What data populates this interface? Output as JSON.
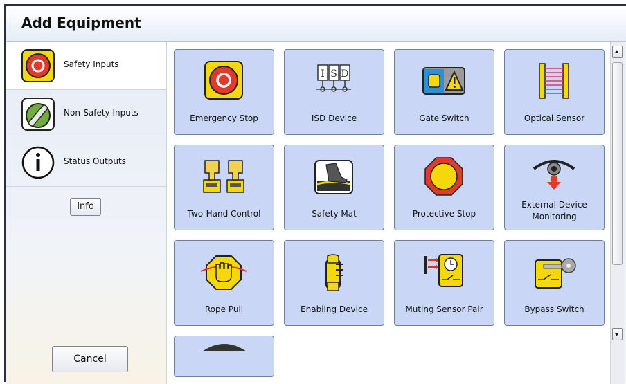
{
  "window": {
    "title": "Add Equipment"
  },
  "sidebar": {
    "items": [
      {
        "label": "Safety Inputs",
        "icon": "emergency-stop-icon"
      },
      {
        "label": "Non-Safety Inputs",
        "icon": "selector-switch-icon"
      },
      {
        "label": "Status Outputs",
        "icon": "info-circle-icon"
      }
    ],
    "info_button": "Info",
    "cancel_button": "Cancel"
  },
  "tiles": [
    {
      "label": "Emergency Stop",
      "icon": "emergency-stop-icon"
    },
    {
      "label": "ISD Device",
      "icon": "isd-device-icon"
    },
    {
      "label": "Gate Switch",
      "icon": "gate-switch-icon"
    },
    {
      "label": "Optical Sensor",
      "icon": "optical-sensor-icon"
    },
    {
      "label": "Two-Hand Control",
      "icon": "two-hand-control-icon"
    },
    {
      "label": "Safety Mat",
      "icon": "safety-mat-icon"
    },
    {
      "label": "Protective Stop",
      "icon": "protective-stop-icon"
    },
    {
      "label": "External Device Monitoring",
      "icon": "eye-monitoring-icon"
    },
    {
      "label": "Rope Pull",
      "icon": "rope-pull-icon"
    },
    {
      "label": "Enabling Device",
      "icon": "enabling-device-icon"
    },
    {
      "label": "Muting Sensor Pair",
      "icon": "muting-sensor-icon"
    },
    {
      "label": "Bypass Switch",
      "icon": "bypass-switch-icon"
    }
  ],
  "colors": {
    "tile_bg": "#c9d6f5",
    "accent_yellow": "#f5d80c",
    "stop_red": "#e23a2a"
  }
}
